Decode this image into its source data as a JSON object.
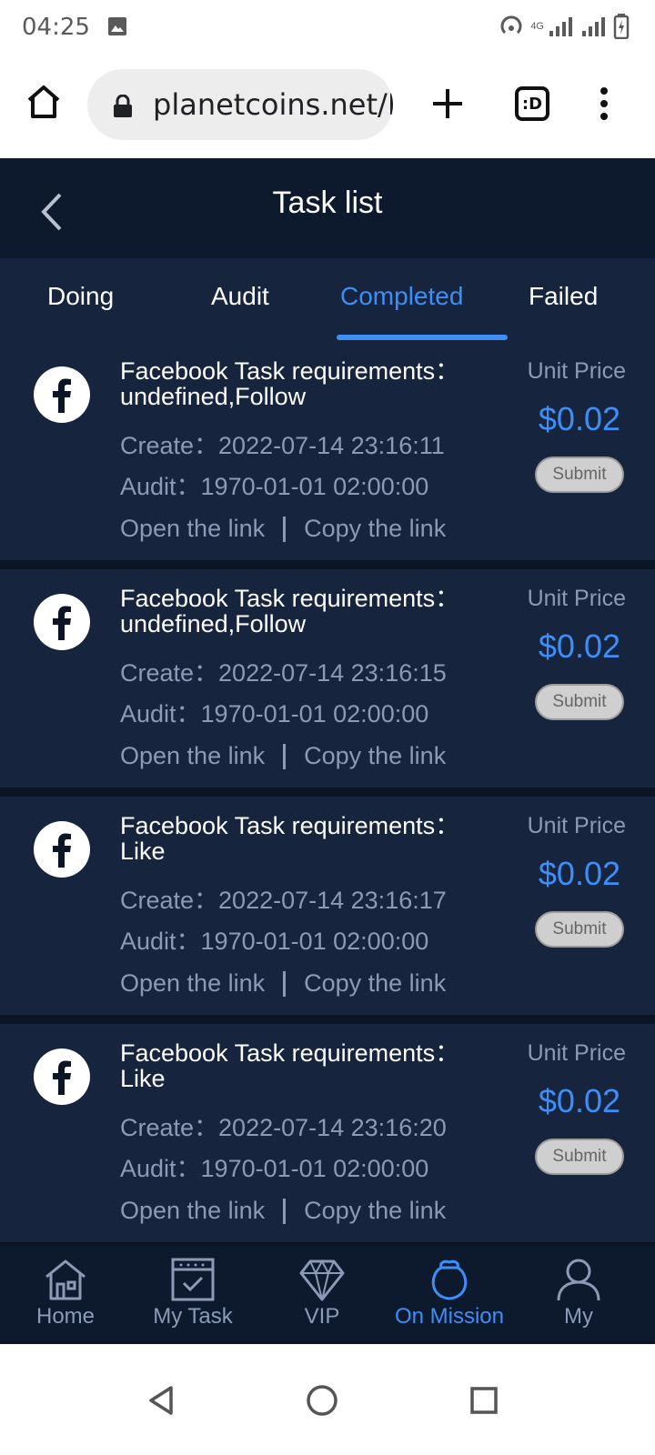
{
  "status_bar": {
    "time": "04:25",
    "network": "4G"
  },
  "browser": {
    "url": "planetcoins.net/H",
    "tabs_label": ":D"
  },
  "header": {
    "title": "Task list"
  },
  "tabs": [
    {
      "label": "Doing",
      "active": false
    },
    {
      "label": "Audit",
      "active": false
    },
    {
      "label": "Completed",
      "active": true
    },
    {
      "label": "Failed",
      "active": false
    }
  ],
  "tasks": [
    {
      "title": "Facebook Task requirements：undefined,Follow",
      "create": "Create：2022-07-14 23:16:11",
      "audit": "Audit：1970-01-01 02:00:00",
      "open_link": "Open the link",
      "copy_link": "Copy the link",
      "unit_price_label": "Unit Price",
      "price": "$0.02",
      "submit": "Submit"
    },
    {
      "title": "Facebook Task requirements：undefined,Follow",
      "create": "Create：2022-07-14 23:16:15",
      "audit": "Audit：1970-01-01 02:00:00",
      "open_link": "Open the link",
      "copy_link": "Copy the link",
      "unit_price_label": "Unit Price",
      "price": "$0.02",
      "submit": "Submit"
    },
    {
      "title": "Facebook Task requirements：Like",
      "create": "Create：2022-07-14 23:16:17",
      "audit": "Audit：1970-01-01 02:00:00",
      "open_link": "Open the link",
      "copy_link": "Copy the link",
      "unit_price_label": "Unit Price",
      "price": "$0.02",
      "submit": "Submit"
    },
    {
      "title": "Facebook Task requirements：Like",
      "create": "Create：2022-07-14 23:16:20",
      "audit": "Audit：1970-01-01 02:00:00",
      "open_link": "Open the link",
      "copy_link": "Copy the link",
      "unit_price_label": "Unit Price",
      "price": "$0.02",
      "submit": "Submit"
    }
  ],
  "bottom_nav": [
    {
      "label": "Home",
      "icon": "home-icon",
      "active": false
    },
    {
      "label": "My Task",
      "icon": "calendar-check-icon",
      "active": false
    },
    {
      "label": "VIP",
      "icon": "diamond-icon",
      "active": false
    },
    {
      "label": "On Mission",
      "icon": "money-bag-icon",
      "active": true
    },
    {
      "label": "My",
      "icon": "user-icon",
      "active": false
    }
  ],
  "colors": {
    "accent": "#3d8ef7",
    "background": "#0b1526",
    "card": "#16243d",
    "muted_text": "#8d9ab5"
  }
}
